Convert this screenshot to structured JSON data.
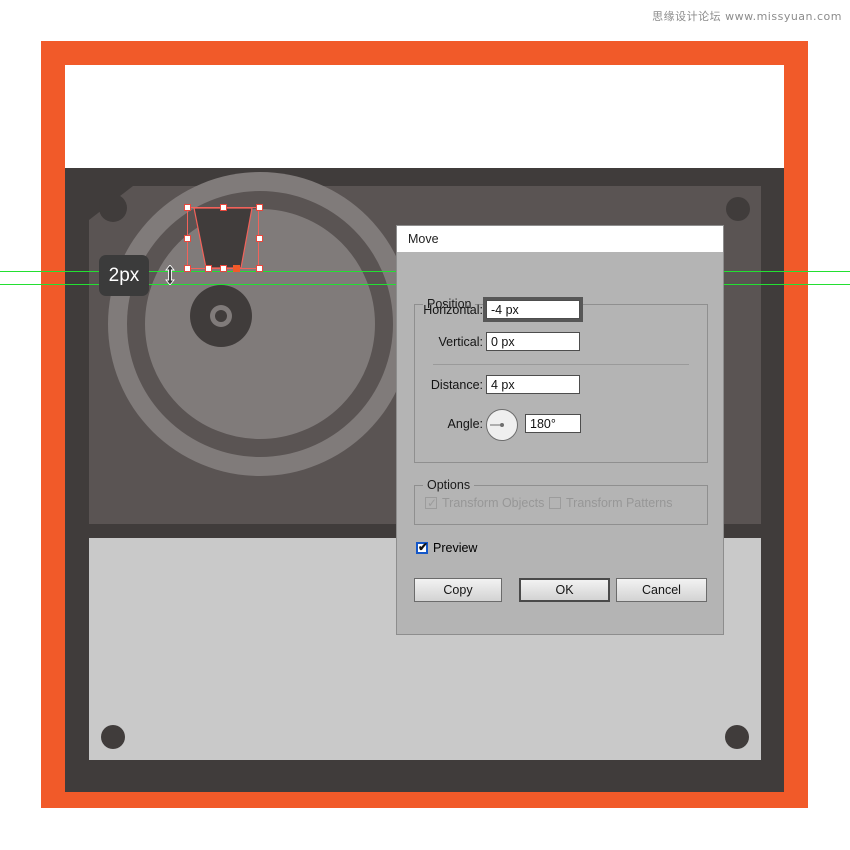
{
  "watermark": "思缘设计论坛 www.missyuan.com",
  "canvas": {
    "tooltip_label": "2px",
    "selection_name": "trapezoid-shape",
    "colors": {
      "orange_border": "#f15a29",
      "body_dark": "#403c3b",
      "plate_gray": "#5a5453",
      "record_gray": "#807b7a",
      "panel_light": "#c9c9c9",
      "guide_green": "#22e032",
      "selection_red": "#f3625a"
    }
  },
  "dialog": {
    "title": "Move",
    "position_group": {
      "legend": "Position",
      "horizontal_label": "Horizontal:",
      "horizontal_value": "-4 px",
      "vertical_label": "Vertical:",
      "vertical_value": "0 px",
      "distance_label": "Distance:",
      "distance_value": "4 px",
      "angle_label": "Angle:",
      "angle_value": "180°"
    },
    "options_group": {
      "legend": "Options",
      "transform_objects_label": "Transform Objects",
      "transform_objects_checked": true,
      "transform_patterns_label": "Transform Patterns",
      "transform_patterns_checked": false
    },
    "preview_label": "Preview",
    "preview_checked": true,
    "buttons": {
      "copy": "Copy",
      "ok": "OK",
      "cancel": "Cancel"
    }
  }
}
